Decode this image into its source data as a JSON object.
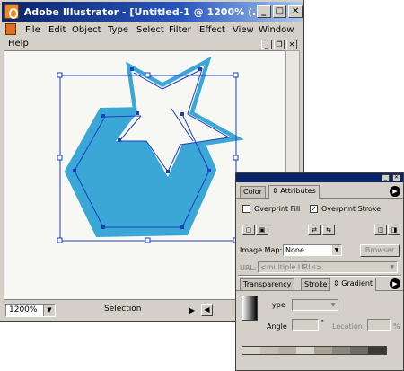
{
  "window": {
    "title": "Adobe Illustrator - [Untitled-1 @ 1200% (...",
    "min_glyph": "_",
    "max_glyph": "□",
    "close_glyph": "✕"
  },
  "menu": [
    "File",
    "Edit",
    "Object",
    "Type",
    "Select",
    "Filter",
    "Effect",
    "View",
    "Window",
    "Help"
  ],
  "mdi": {
    "min_glyph": "_",
    "restore_glyph": "❐",
    "close_glyph": "✕"
  },
  "status": {
    "zoom": "1200%",
    "tool": "Selection"
  },
  "panel": {
    "top_tabs": [
      "Color",
      "Attributes"
    ],
    "overprint_fill": "Overprint Fill",
    "overprint_stroke": "Overprint Stroke",
    "overprint_stroke_checked": "✓",
    "image_map_label": "Image Map:",
    "image_map_value": "None",
    "browser_label": "Browser",
    "url_label": "URL:",
    "url_value": "<multiple URLs>",
    "bottom_tabs": [
      "Transparency",
      "Stroke",
      "Gradient"
    ],
    "type_label": "ype",
    "angle_label": "Angle",
    "angle_unit": "°",
    "location_label": "Location:",
    "location_unit": "%"
  },
  "colors": {
    "shape_fill": "#3aa7d6",
    "selection": "#1f3fbf",
    "titlebar": "#0a246a"
  },
  "gradient_bar_colors": [
    "#d6d2c6",
    "#c4bfb2",
    "#b6b0a2",
    "#d8d4ca",
    "#a8a294",
    "#8c877c",
    "#6e6a62",
    "#3c3a36"
  ]
}
